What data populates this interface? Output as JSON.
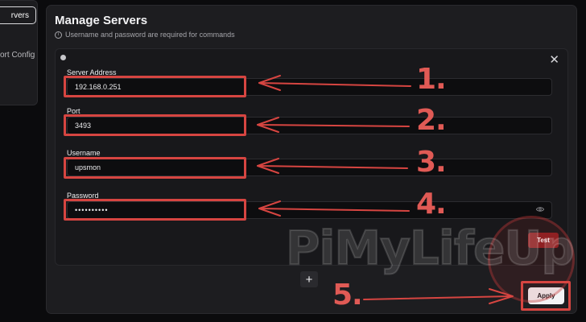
{
  "sidebar": {
    "items": [
      {
        "label": "rvers"
      },
      {
        "label": "ort Config"
      }
    ]
  },
  "header": {
    "title": "Manage Servers",
    "subtitle": "Username and password are required for commands"
  },
  "server": {
    "fields": [
      {
        "label": "Server Address",
        "value": "192.168.0.251"
      },
      {
        "label": "Port",
        "value": "3493"
      },
      {
        "label": "Username",
        "value": "upsmon"
      },
      {
        "label": "Password",
        "value": "••••••••••"
      }
    ],
    "test_label": "Test"
  },
  "footer": {
    "add_label": "+",
    "apply_label": "Apply"
  },
  "annotations": {
    "steps": [
      "1.",
      "2.",
      "3.",
      "4.",
      "5."
    ],
    "watermark": "PiMyLifeUp",
    "color": "#d64541"
  }
}
